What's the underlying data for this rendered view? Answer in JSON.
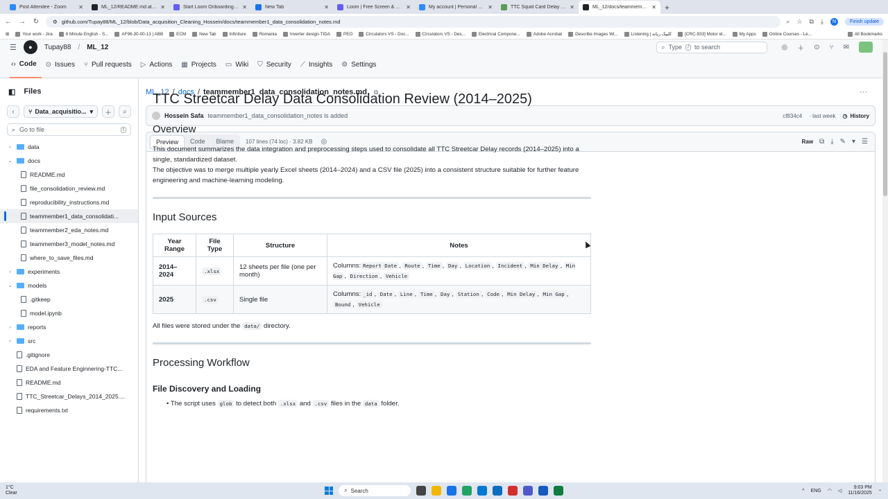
{
  "browser": {
    "tabs": [
      {
        "label": "Post Attendee - Zoom",
        "color": "#2d8cff"
      },
      {
        "label": "ML_12/README.md at consolida",
        "color": "#1f2328"
      },
      {
        "label": "Start Loom Onboarding | Loom",
        "color": "#625df5"
      },
      {
        "label": "New Tab",
        "color": "#1a73e8"
      },
      {
        "label": "Loom | Free Screen & Video Re",
        "color": "#625df5"
      },
      {
        "label": "My account | Personal Settings",
        "color": "#2d8cff"
      },
      {
        "label": "TTC Squid Card Delay Project O",
        "color": "#5a9c58"
      },
      {
        "label": "ML_12/docs/teammember1_da",
        "color": "#1f2328"
      }
    ],
    "active_tab": 7,
    "url": "github.com/Tupay88/ML_12/blob/Data_acquisition_Cleaning_Hossein/docs/teammember1_data_consolidation_notes.md",
    "finish_update": "Finish update",
    "profile_letter": "N",
    "bookmarks": [
      "Your work - Jira",
      "6 Minute English - S...",
      "AF96-30-00-13 | ABB",
      "ECM",
      "New Tab",
      "Infiniture",
      "Romania",
      "Inverter design-TIDA",
      "PEO",
      "Circulators VS - Doc...",
      "Circulators VS - Des...",
      "Electrical Compone...",
      "Adobe Acrobat",
      "Describe Images Wi...",
      "Listening | کلیپک زبانه",
      "[CRC-933] Motor id...",
      "My Apps",
      "Online Courses - Le..."
    ],
    "all_bookmarks": "All Bookmarks"
  },
  "github": {
    "owner": "Tupay88",
    "repo": "ML_12",
    "search_prefix": "Type",
    "search_key": "/",
    "search_suffix": "to search",
    "repo_tabs": [
      "Code",
      "Issues",
      "Pull requests",
      "Actions",
      "Projects",
      "Wiki",
      "Security",
      "Insights",
      "Settings"
    ],
    "sidebar": {
      "title": "Files",
      "branch": "Data_acquisitio...",
      "goto_placeholder": "Go to file",
      "goto_key": "t",
      "tree": [
        {
          "name": "data",
          "type": "folder",
          "depth": 0,
          "open": false
        },
        {
          "name": "docs",
          "type": "folder",
          "depth": 0,
          "open": true
        },
        {
          "name": "README.md",
          "type": "file",
          "depth": 1
        },
        {
          "name": "file_consolidation_review.md",
          "type": "file",
          "depth": 1
        },
        {
          "name": "reproducibility_instructions.md",
          "type": "file",
          "depth": 1
        },
        {
          "name": "teammember1_data_consolidati...",
          "type": "file",
          "depth": 1,
          "selected": true
        },
        {
          "name": "teammember2_eda_notes.md",
          "type": "file",
          "depth": 1
        },
        {
          "name": "teammember3_model_notes.md",
          "type": "file",
          "depth": 1
        },
        {
          "name": "where_to_save_files.md",
          "type": "file",
          "depth": 1
        },
        {
          "name": "experiments",
          "type": "folder",
          "depth": 0,
          "open": false
        },
        {
          "name": "models",
          "type": "folder",
          "depth": 0,
          "open": true
        },
        {
          "name": ".gitkeep",
          "type": "file",
          "depth": 1
        },
        {
          "name": "model.ipynb",
          "type": "file",
          "depth": 1
        },
        {
          "name": "reports",
          "type": "folder",
          "depth": 0,
          "open": false
        },
        {
          "name": "src",
          "type": "folder",
          "depth": 0,
          "open": false
        },
        {
          "name": ".gitignore",
          "type": "file",
          "depth": 0
        },
        {
          "name": "EDA and Feature Enginnering-TTC...",
          "type": "file",
          "depth": 0
        },
        {
          "name": "README.md",
          "type": "file",
          "depth": 0
        },
        {
          "name": "TTC_Streetcar_Delays_2014_2025....",
          "type": "file",
          "depth": 0
        },
        {
          "name": "requirements.txt",
          "type": "file",
          "depth": 0
        }
      ]
    },
    "path": {
      "root": "ML_12",
      "folder": "docs",
      "file": "teammember1_data_consolidation_notes.md"
    },
    "commit": {
      "author": "Hossein Safa",
      "message": "teammember1_data_consolidation_notes is added",
      "sha": "cf834c4",
      "when": "· last week",
      "history": "History"
    },
    "file_header": {
      "views": [
        "Preview",
        "Code",
        "Blame"
      ],
      "meta": "107 lines (74 loc) · 3.82 KB",
      "raw": "Raw"
    }
  },
  "doc": {
    "h1": "TTC Streetcar Delay Data Consolidation Review (2014–2025)",
    "overview_h": "Overview",
    "overview_p1": "This document summarizes the data integration and preprocessing steps used to consolidate all TTC Streetcar Delay records (2014–2025) into a single, standardized dataset.",
    "overview_p2": "The objective was to merge multiple yearly Excel sheets (2014–2024) and a CSV file (2025) into a consistent structure suitable for further feature engineering and machine-learning modeling.",
    "input_h": "Input Sources",
    "table": {
      "headers": [
        "Year Range",
        "File Type",
        "Structure",
        "Notes"
      ],
      "rows": [
        {
          "year": "2014–2024",
          "type": ".xlsx",
          "structure": "12 sheets per file (one per month)",
          "notes_prefix": "Columns:",
          "cols": [
            "Report Date",
            "Route",
            "Time",
            "Day",
            "Location",
            "Incident",
            "Min Delay",
            "Min Gap",
            "Direction",
            "Vehicle"
          ]
        },
        {
          "year": "2025",
          "type": ".csv",
          "structure": "Single file",
          "notes_prefix": "Columns:",
          "cols": [
            "_id",
            "Date",
            "Line",
            "Time",
            "Day",
            "Station",
            "Code",
            "Min Delay",
            "Min Gap",
            "Bound",
            "Vehicle"
          ]
        }
      ]
    },
    "stored_pre": "All files were stored under the",
    "stored_code": "data/",
    "stored_post": "directory.",
    "workflow_h": "Processing Workflow",
    "discovery_h": "File Discovery and Loading",
    "bullet_pre": "The script uses",
    "bullet_code1": "glob",
    "bullet_mid1": "to detect both",
    "bullet_code2": ".xlsx",
    "bullet_mid2": "and",
    "bullet_code3": ".csv",
    "bullet_mid3": "files in the",
    "bullet_code4": "data",
    "bullet_post": "folder."
  },
  "taskbar": {
    "temp": "1°C",
    "cond": "Clear",
    "search": "Search",
    "lang": "ENG",
    "time": "9:03 PM",
    "date": "11/16/2025"
  }
}
